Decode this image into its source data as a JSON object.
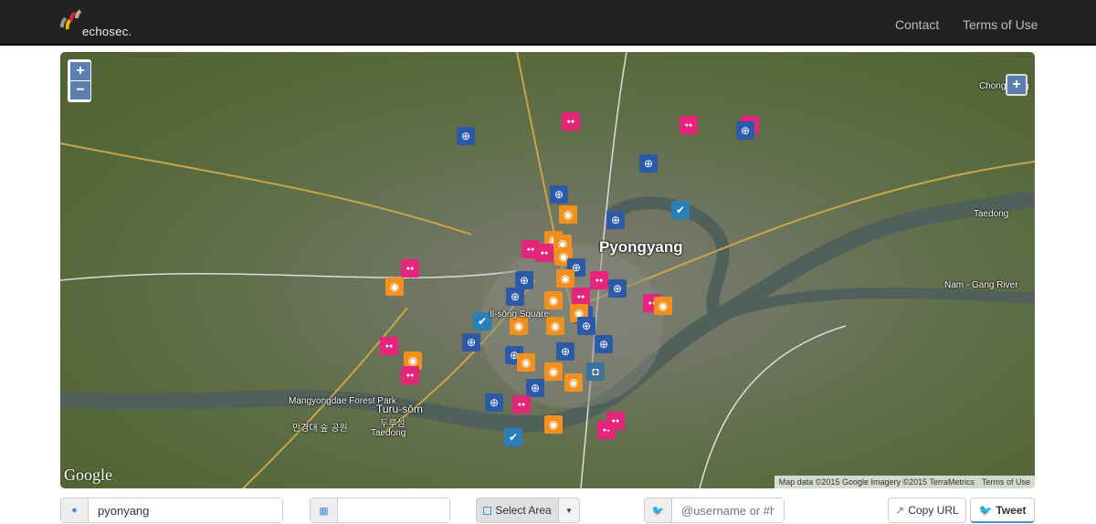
{
  "nav": {
    "brand": "echosec.",
    "links": [
      "Contact",
      "Terms of Use"
    ]
  },
  "map": {
    "zoom_in": "+",
    "zoom_out": "−",
    "expand": "+",
    "labels": {
      "city": "Pyongyang",
      "chong_dong": "Chong-dong",
      "taedong_east": "Taedong",
      "nam_gang": "Nam - Gang River",
      "square": "Il-sŏng Square",
      "forest": "Mangyongdae Forest Park",
      "forest_kr": "만경대 숲 공원",
      "turu": "Turu-sŏm",
      "turu_kr": "두루섬",
      "taedong_west": "Taedong"
    },
    "google": "Google",
    "attribution": "Map data ©2015 Google Imagery ©2015 TerraMetrics",
    "terms": "Terms of Use",
    "colors": {
      "flickr": "#e5247b",
      "weibo": "#f0901e",
      "foursquare": "#2d5aa6",
      "vk": "#2a7fb8",
      "instagram": "#3f729b"
    }
  },
  "toolbar": {
    "location_value": "pyonyang",
    "date_value": "",
    "select_area": "Select Area",
    "user_placeholder": "@username or #hashtag",
    "copy_url": "Copy URL",
    "tweet": "Tweet"
  }
}
